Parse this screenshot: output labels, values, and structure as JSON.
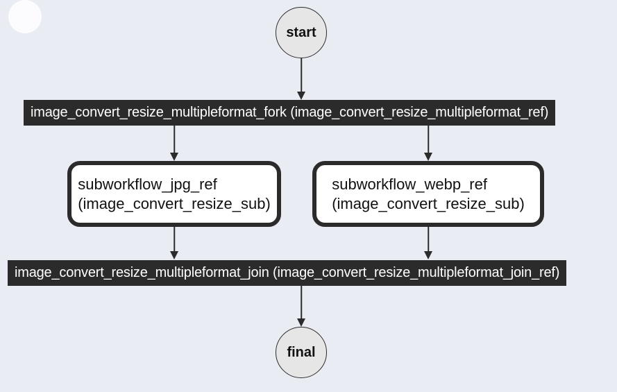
{
  "diagram": {
    "type": "workflow-graph",
    "start_label": "start",
    "final_label": "final",
    "fork_node": "image_convert_resize_multipleformat_fork (image_convert_resize_multipleformat_ref)",
    "join_node": "image_convert_resize_multipleformat_join (image_convert_resize_multipleformat_join_ref)",
    "sub_jpg_line1": "subworkflow_jpg_ref",
    "sub_jpg_line2": "(image_convert_resize_sub)",
    "sub_webp_line1": "subworkflow_webp_ref",
    "sub_webp_line2": "(image_convert_resize_sub)",
    "edges": [
      {
        "from": "start",
        "to": "fork"
      },
      {
        "from": "fork",
        "to": "sub_jpg"
      },
      {
        "from": "fork",
        "to": "sub_webp"
      },
      {
        "from": "sub_jpg",
        "to": "join"
      },
      {
        "from": "sub_webp",
        "to": "join"
      },
      {
        "from": "join",
        "to": "final"
      }
    ]
  }
}
